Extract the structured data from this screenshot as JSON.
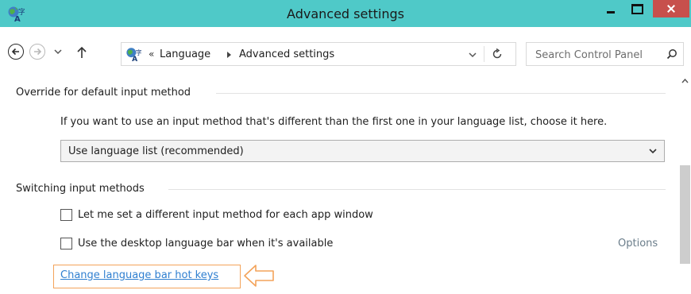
{
  "window": {
    "title": "Advanced settings",
    "titlebar_color": "#4fc9c8",
    "close_color": "#c7504c",
    "app_icon": "language-globe-icon"
  },
  "nav": {
    "breadcrumb": {
      "overflow": "«",
      "items": [
        "Language",
        "Advanced settings"
      ]
    },
    "search": {
      "placeholder": "Search Control Panel"
    }
  },
  "content": {
    "sections": [
      {
        "title": "Override for default input method",
        "description": "If you want to use an input method that's different than the first one in your language list, choose it here.",
        "select_value": "Use language list (recommended)"
      },
      {
        "title": "Switching input methods",
        "checkboxes": [
          {
            "label": "Let me set a different input method for each app window",
            "checked": false
          },
          {
            "label": "Use the desktop language bar when it's available",
            "checked": false
          }
        ],
        "options_link": "Options",
        "hotkeys_link": "Change language bar hot keys"
      }
    ],
    "highlight_color": "#f3a35a",
    "link_color": "#2f7fd0"
  }
}
